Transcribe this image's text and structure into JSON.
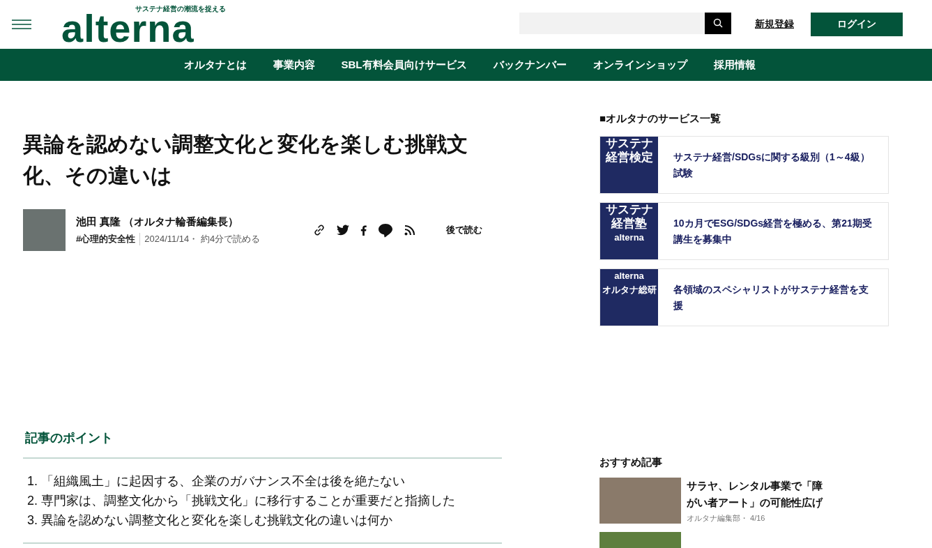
{
  "header": {
    "logo": "alterna",
    "tagline": "サステナ経営の潮流を捉える",
    "register_link": "新規登録",
    "login_button": "ログイン"
  },
  "nav": {
    "items": [
      "オルタナとは",
      "事業内容",
      "SBL有料会員向けサービス",
      "バックナンバー",
      "オンラインショップ",
      "採用情報"
    ]
  },
  "article": {
    "title": "異論を認めない調整文化と変化を楽しむ挑戦文化、その違いは",
    "author": "池田 真隆 （オルタナ輪番編集長）",
    "tag": "#心理的安全性",
    "date": "2024/11/14・",
    "read_time": "約4分で読める",
    "read_later": "後で読む",
    "points_heading": "記事のポイント",
    "points": [
      "1. 「組織風土」に起因する、企業のガバナンス不全は後を絶たない",
      "2. 専門家は、調整文化から「挑戦文化」に移行することが重要だと指摘した",
      "3. 異論を認めない調整文化と変化を楽しむ挑戦文化の違いは何か"
    ]
  },
  "sidebar": {
    "services_heading": "■オルタナのサービス一覧",
    "services": [
      {
        "banner_lines": [
          "サステナ",
          "経営検定"
        ],
        "text": "サステナ経営/SDGsに関する級別（1～4級）試験"
      },
      {
        "banner_lines": [
          "サステナ",
          "経営塾",
          "alterna"
        ],
        "text": "10カ月でESG/SDGs経営を極める、第21期受講生を募集中"
      },
      {
        "banner_lines": [
          "alterna",
          "オルタナ総研"
        ],
        "text": "各領域のスペシャリストがサステナ経営を支援"
      }
    ],
    "recommended_heading": "おすすめ記事",
    "recommended": [
      {
        "title": "サラヤ、レンタル事業で「障がい者アート」の可能性広げ",
        "meta": "オルタナ編集部・ 4/16"
      }
    ]
  }
}
